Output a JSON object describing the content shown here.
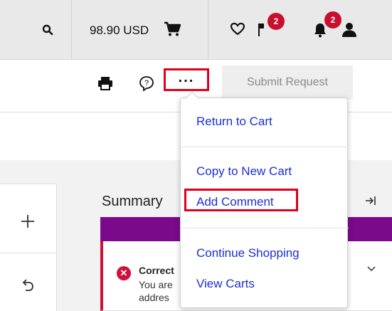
{
  "header": {
    "cart_total": "98.90 USD",
    "flag_badge": "2",
    "notification_badge": "2"
  },
  "actions": {
    "more_label": "...",
    "help_label": "?",
    "submit_label": "Submit Request"
  },
  "menu": {
    "items": [
      "Return to Cart",
      "Copy to New Cart",
      "Add Comment",
      "Continue Shopping",
      "View Carts"
    ]
  },
  "summary": {
    "title": "Summary",
    "alert_title": "Correct",
    "alert_line1": "You are",
    "alert_line2": "addres"
  },
  "colors": {
    "highlight": "#e0001b",
    "link": "#1a2fd6",
    "badge": "#c8102e",
    "purple": "#7a0a8a"
  }
}
